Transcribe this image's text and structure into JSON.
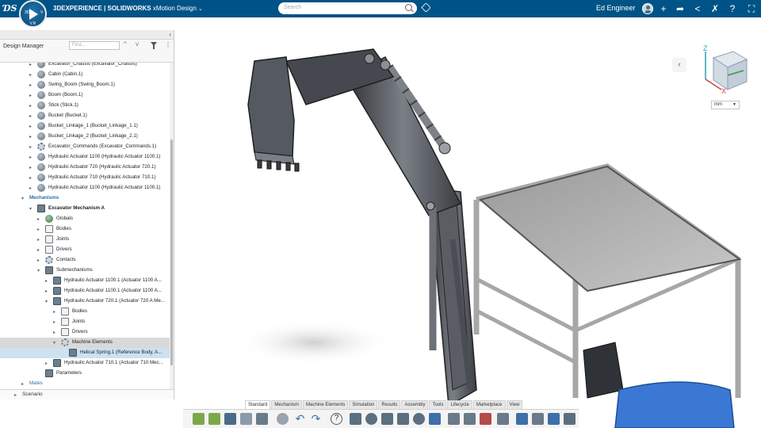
{
  "app": {
    "brand_prefix": "3DEXPERIENCE | ",
    "brand_main": "SOLIDWORKS",
    "brand_app": " xMotion Design",
    "compass": {
      "north": "3D",
      "east": "V",
      "south": "",
      "west": "",
      "version": "V.R"
    },
    "search_placeholder": "Search",
    "user_name": "Ed Engineer",
    "icons": [
      "search-icon",
      "tag-icon",
      "add-icon",
      "share-icon",
      "network-icon",
      "collaborate-icon",
      "help-icon",
      "fullscreen-icon"
    ]
  },
  "panel": {
    "title": "Design Manager",
    "find_placeholder": "Find...",
    "scenario": "Scenario",
    "tree": [
      {
        "label": "Excavator_Chassis (Excavator_Chassis)",
        "icon": "part",
        "level": 1
      },
      {
        "label": "Cabin (Cabin.1)",
        "icon": "part",
        "level": 1
      },
      {
        "label": "Swing_Boom (Swing_Boom.1)",
        "icon": "part",
        "level": 1
      },
      {
        "label": "Boom (Boom.1)",
        "icon": "part",
        "level": 1
      },
      {
        "label": "Stick (Stick.1)",
        "icon": "part",
        "level": 1
      },
      {
        "label": "Bucket (Bucket.1)",
        "icon": "part",
        "level": 1
      },
      {
        "label": "Bucket_Linkage_1 (Bucket_Linkage_1.1)",
        "icon": "part",
        "level": 1
      },
      {
        "label": "Bucket_Linkage_2 (Bucket_Linkage_2.1)",
        "icon": "part",
        "level": 1
      },
      {
        "label": "Excavator_Commands (Excavator_Commands.1)",
        "icon": "gear",
        "level": 1
      },
      {
        "label": "Hydraulic Actuator 1100 (Hydraulic Actuator 1100.1)",
        "icon": "part",
        "level": 1
      },
      {
        "label": "Hydraulic Actuator 720 (Hydraulic Actuator 720.1)",
        "icon": "part",
        "level": 1
      },
      {
        "label": "Hydraulic Actuator 710 (Hydraulic Actuator 710.1)",
        "icon": "part",
        "level": 1
      },
      {
        "label": "Hydraulic Actuator 1100 (Hydraulic Actuator 1100.1)",
        "icon": "part",
        "level": 1
      },
      {
        "label": "Mechanisms",
        "icon": "none",
        "level": 0,
        "style": "blue"
      },
      {
        "label": "Excavator Mechanism A",
        "icon": "mech",
        "level": 1,
        "style": "bold"
      },
      {
        "label": "Globals",
        "icon": "globe",
        "level": 2
      },
      {
        "label": "Bodies",
        "icon": "folder",
        "level": 2
      },
      {
        "label": "Joints",
        "icon": "folder",
        "level": 2
      },
      {
        "label": "Drivers",
        "icon": "folder",
        "level": 2
      },
      {
        "label": "Contacts",
        "icon": "gear",
        "level": 2
      },
      {
        "label": "Submechanisms",
        "icon": "mech",
        "level": 2
      },
      {
        "label": "Hydraulic Actuator 1100.1 (Actuator 1100 A...",
        "icon": "mech",
        "level": 3
      },
      {
        "label": "Hydraulic Actuator 1100.1 (Actuator 1100 A...",
        "icon": "mech",
        "level": 3
      },
      {
        "label": "Hydraulic Actuator 720.1 (Actuator 720 A Me...",
        "icon": "mech",
        "level": 3
      },
      {
        "label": "Bodies",
        "icon": "folder",
        "level": 4
      },
      {
        "label": "Joints",
        "icon": "folder",
        "level": 4
      },
      {
        "label": "Drivers",
        "icon": "folder",
        "level": 4
      },
      {
        "label": "Machine Elements",
        "icon": "gear",
        "level": 4,
        "state": "hover"
      },
      {
        "label": "Helical Spring.1 (Reference Body, A...",
        "icon": "mech",
        "level": 5,
        "state": "selected"
      },
      {
        "label": "Hydraulic Actuator 710.1 (Actuator 710 Mec...",
        "icon": "mech",
        "level": 3
      },
      {
        "label": "Parameters",
        "icon": "mech",
        "level": 2
      },
      {
        "label": "Mates",
        "icon": "none",
        "level": 0,
        "style": "blue-plain"
      }
    ]
  },
  "viewport": {
    "unit": "mm",
    "axes": {
      "z": "Z",
      "x": "X"
    }
  },
  "action_bar": {
    "tabs": [
      "Standard",
      "Mechanism",
      "Machine Elements",
      "Simulation",
      "Results",
      "Assembly",
      "Tools",
      "Lifecycle",
      "Marketplace",
      "View"
    ],
    "active_tab": "Standard"
  },
  "colors": {
    "topbar": "#005386",
    "selection": "#cde1f0",
    "link": "#2b6fa8",
    "cabin_blue": "#3a78d4"
  }
}
